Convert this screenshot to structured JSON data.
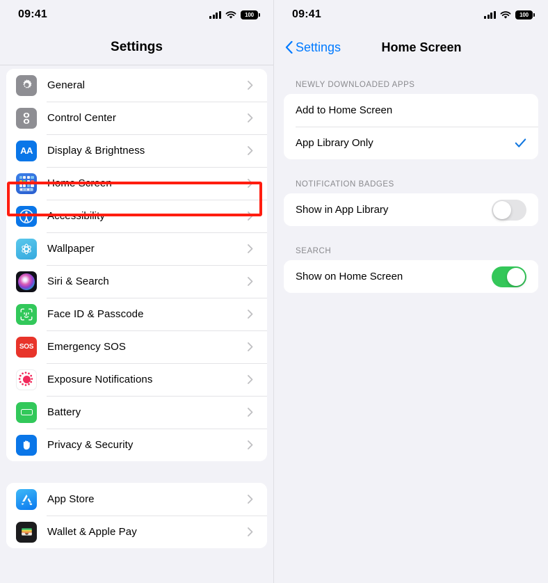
{
  "status_bar": {
    "time": "09:41",
    "battery_level": "100",
    "icons": [
      "cellular-signal-icon",
      "wifi-icon",
      "battery-icon"
    ]
  },
  "left_pane": {
    "nav_title": "Settings",
    "groups": [
      {
        "items": [
          {
            "label": "General",
            "icon": "gear-icon"
          },
          {
            "label": "Control Center",
            "icon": "control-center-icon"
          },
          {
            "label": "Display & Brightness",
            "icon": "display-brightness-icon",
            "icon_text": "AA"
          },
          {
            "label": "Home Screen",
            "icon": "home-screen-icon",
            "highlighted": true
          },
          {
            "label": "Accessibility",
            "icon": "accessibility-icon"
          },
          {
            "label": "Wallpaper",
            "icon": "wallpaper-icon"
          },
          {
            "label": "Siri & Search",
            "icon": "siri-icon"
          },
          {
            "label": "Face ID & Passcode",
            "icon": "face-id-icon"
          },
          {
            "label": "Emergency SOS",
            "icon": "emergency-sos-icon",
            "icon_text": "SOS"
          },
          {
            "label": "Exposure Notifications",
            "icon": "exposure-notifications-icon"
          },
          {
            "label": "Battery",
            "icon": "battery-settings-icon"
          },
          {
            "label": "Privacy & Security",
            "icon": "privacy-hand-icon"
          }
        ]
      },
      {
        "items": [
          {
            "label": "App Store",
            "icon": "app-store-icon"
          },
          {
            "label": "Wallet & Apple Pay",
            "icon": "wallet-icon"
          }
        ]
      }
    ]
  },
  "right_pane": {
    "back_label": "Settings",
    "nav_title": "Home Screen",
    "sections": [
      {
        "header": "NEWLY DOWNLOADED APPS",
        "rows": [
          {
            "label": "Add to Home Screen",
            "control": "none",
            "selected": false
          },
          {
            "label": "App Library Only",
            "control": "checkmark",
            "selected": true
          }
        ]
      },
      {
        "header": "NOTIFICATION BADGES",
        "rows": [
          {
            "label": "Show in App Library",
            "control": "toggle",
            "value": "off"
          }
        ]
      },
      {
        "header": "SEARCH",
        "rows": [
          {
            "label": "Show on Home Screen",
            "control": "toggle",
            "value": "on"
          }
        ]
      }
    ]
  },
  "colors": {
    "accent_blue": "#007aff",
    "toggle_on_green": "#34c759",
    "toggle_off_gray": "#e4e4e6",
    "highlight_red": "#ff1d10",
    "page_background": "#f2f2f7"
  }
}
